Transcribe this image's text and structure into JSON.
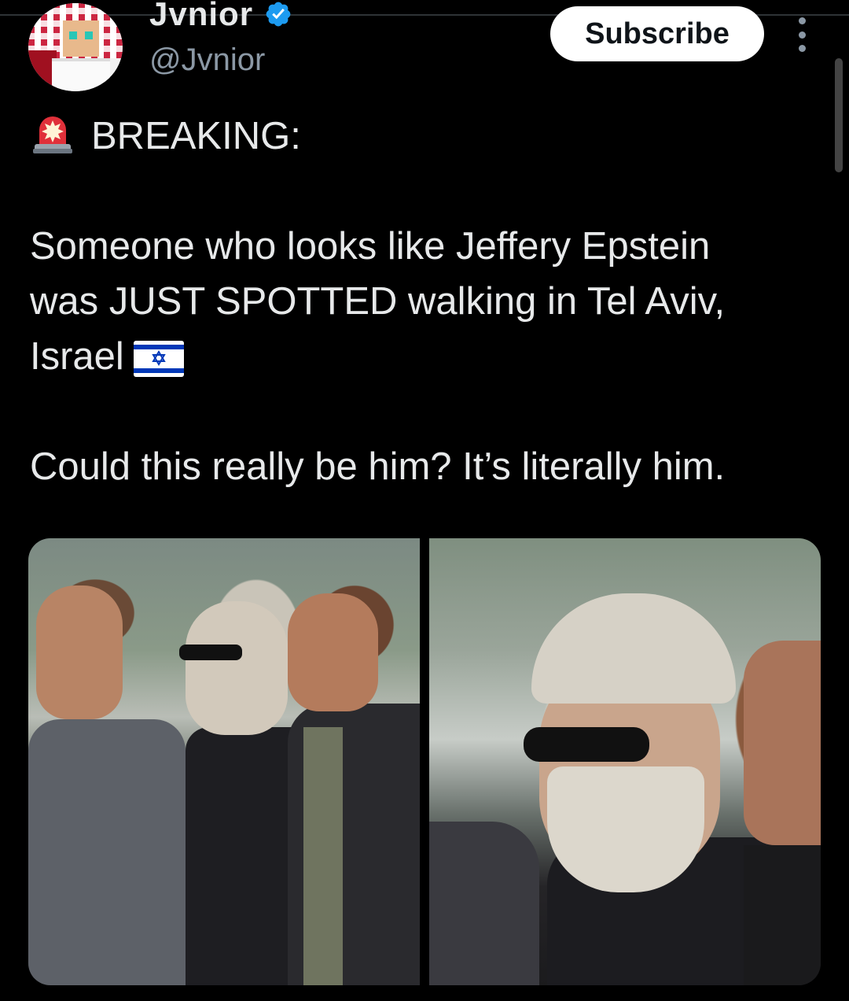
{
  "author": {
    "display_name": "Jvnior",
    "handle": "@Jvnior",
    "verified": true
  },
  "actions": {
    "subscribe_label": "Subscribe"
  },
  "tweet": {
    "line1": "BREAKING:",
    "line2": "Someone who looks like Jeffery Epstein",
    "line3": "was JUST SPOTTED walking in Tel Aviv,",
    "line4": "Israel",
    "line5": "Could this really be him? It’s literally him."
  },
  "icons": {
    "siren": "rotating-light-emoji",
    "flag": "israel-flag-emoji",
    "verified": "verified-badge",
    "more": "more-vertical"
  },
  "colors": {
    "background": "#000000",
    "text": "#e7e9ea",
    "secondary_text": "#8b98a5",
    "verified_blue": "#1d9bf0",
    "button_bg": "#ffffff"
  },
  "media": {
    "count": 2
  }
}
